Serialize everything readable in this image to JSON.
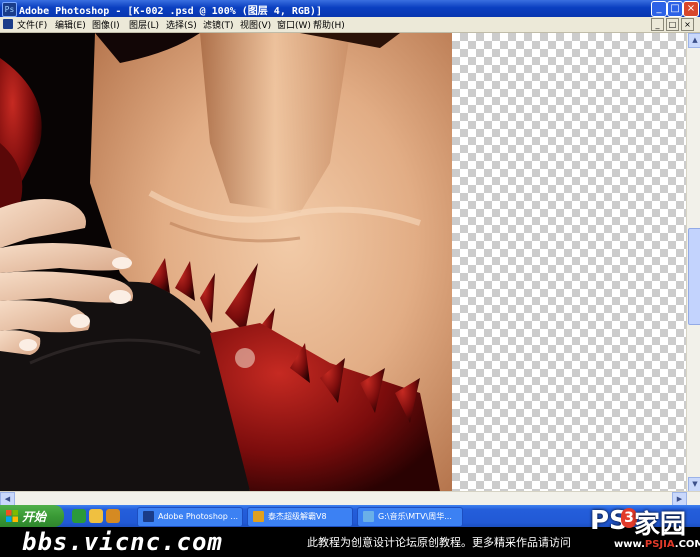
{
  "window": {
    "app_icon": "Ps",
    "title": "Adobe Photoshop - [K-002 .psd @ 100% (图层 4, RGB)]",
    "buttons": {
      "minimize": "_",
      "maximize": "□",
      "close": "×"
    }
  },
  "menu": {
    "items": [
      "文件(F)",
      "编辑(E)",
      "图像(I)",
      "图层(L)",
      "选择(S)",
      "滤镜(T)",
      "视图(V)",
      "窗口(W)",
      "帮助(H)"
    ],
    "doc_buttons": [
      "_",
      "□",
      "×"
    ]
  },
  "taskbar": {
    "start_label": "开始",
    "tasks": [
      {
        "label": "Adobe Photoshop ...",
        "icon": "photoshop-icon",
        "active": false
      },
      {
        "label": "泰杰超级解霸V8",
        "icon": "media-player-icon",
        "active": false
      },
      {
        "label": "G:\\音乐\\MTV\\周华...",
        "icon": "folder-icon",
        "active": false
      }
    ]
  },
  "watermark": {
    "site": "bbs.vicnc.com",
    "note": "此教程为创意设计论坛原创教程。更多精采作品请访问"
  },
  "logo": {
    "ps": "PS",
    "num": "3",
    "jia": "家园",
    "url_prefix": "www.",
    "url_brand": "PSJIA",
    "url_suffix": ".COM"
  },
  "colors": {
    "titlebar": "#0a3fc0",
    "menubar": "#ece9d8",
    "taskbar": "#245edb",
    "start": "#3a9a36",
    "skin": "#e8b791",
    "dark_red": "#7a0c0c"
  }
}
